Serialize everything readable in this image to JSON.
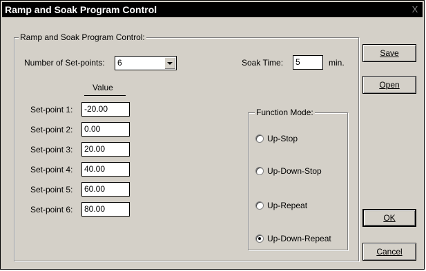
{
  "window": {
    "title": "Ramp and Soak Program Control",
    "close_glyph": "X"
  },
  "group": {
    "legend": "Ramp and Soak Program Control:",
    "setpoints_label": "Number of Set-points:",
    "setpoints_value": "6",
    "soak_label": "Soak Time:",
    "soak_value": "5",
    "soak_unit": "min.",
    "value_header": "Value",
    "setpoints": [
      {
        "label": "Set-point 1:",
        "value": "-20.00"
      },
      {
        "label": "Set-point 2:",
        "value": "0.00"
      },
      {
        "label": "Set-point 3:",
        "value": "20.00"
      },
      {
        "label": "Set-point 4:",
        "value": "40.00"
      },
      {
        "label": "Set-point 5:",
        "value": "60.00"
      },
      {
        "label": "Set-point 6:",
        "value": "80.00"
      }
    ]
  },
  "function_mode": {
    "legend": "Function Mode:",
    "options": [
      {
        "label": "Up-Stop",
        "selected": false
      },
      {
        "label": "Up-Down-Stop",
        "selected": false
      },
      {
        "label": "Up-Repeat",
        "selected": false
      },
      {
        "label": "Up-Down-Repeat",
        "selected": true
      }
    ]
  },
  "buttons": {
    "save": "Save",
    "open": "Open",
    "ok": "OK",
    "cancel": "Cancel"
  }
}
